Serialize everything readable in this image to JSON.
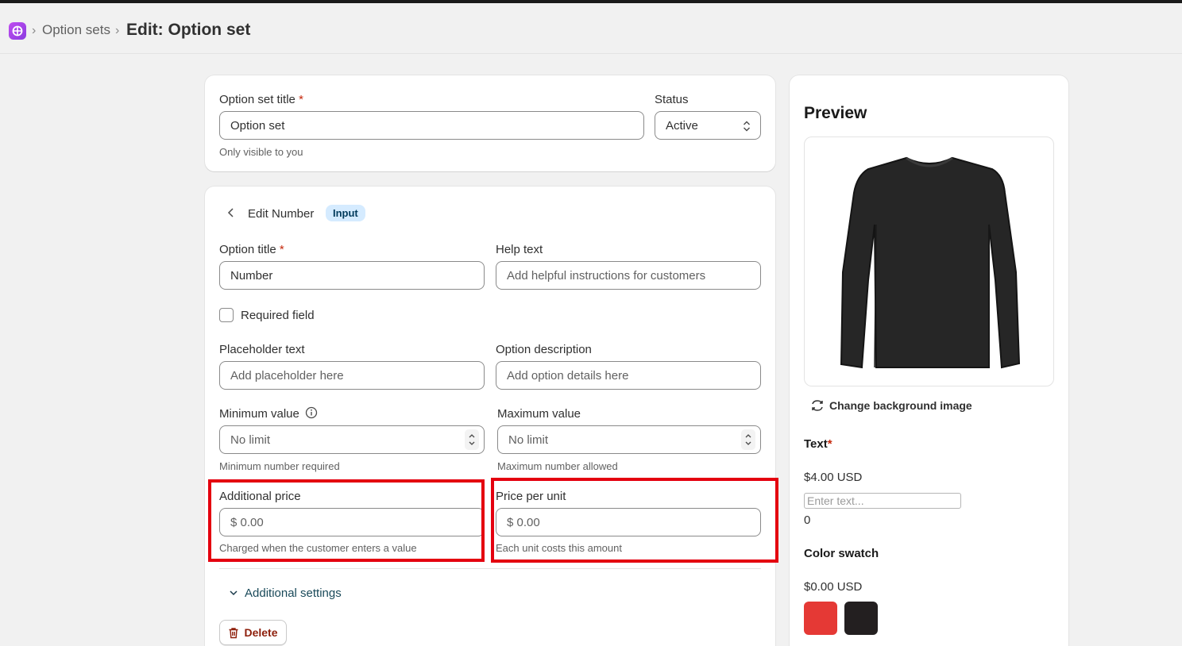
{
  "breadcrumb": {
    "link": "Option sets",
    "separator": "›",
    "title": "Edit: Option set"
  },
  "option_set": {
    "title_label": "Option set title",
    "required_mark": "*",
    "title_value": "Option set",
    "title_hint": "Only visible to you",
    "status_label": "Status",
    "status_value": "Active"
  },
  "editor": {
    "heading": "Edit Number",
    "badge": "Input",
    "option_title_label": "Option title",
    "option_title_value": "Number",
    "help_text_label": "Help text",
    "help_text_placeholder": "Add helpful instructions for customers",
    "required_field_label": "Required field",
    "placeholder_label": "Placeholder text",
    "placeholder_placeholder": "Add placeholder here",
    "description_label": "Option description",
    "description_placeholder": "Add option details here",
    "min_label": "Minimum value",
    "min_value": "No limit",
    "min_hint": "Minimum number required",
    "max_label": "Maximum value",
    "max_value": "No limit",
    "max_hint": "Maximum number allowed",
    "additional_price_label": "Additional price",
    "additional_price_value": "$ 0.00",
    "additional_price_hint": "Charged when the customer enters a value",
    "price_per_unit_label": "Price per unit",
    "price_per_unit_value": "$ 0.00",
    "price_per_unit_hint": "Each unit costs this amount",
    "additional_settings": "Additional settings",
    "delete_label": "Delete"
  },
  "preview": {
    "title": "Preview",
    "change_bg": "Change background image",
    "text_label": "Text",
    "text_required": "*",
    "text_price": "$4.00 USD",
    "text_placeholder": "Enter text...",
    "text_count": "0",
    "swatch_label": "Color swatch",
    "swatch_price": "$0.00 USD",
    "swatch_colors": [
      "#e53935",
      "#231f20"
    ]
  },
  "colors": {
    "accent_blue": "#005bd3",
    "highlight_red": "#e4000f",
    "delete_red": "#8e1f0b"
  }
}
